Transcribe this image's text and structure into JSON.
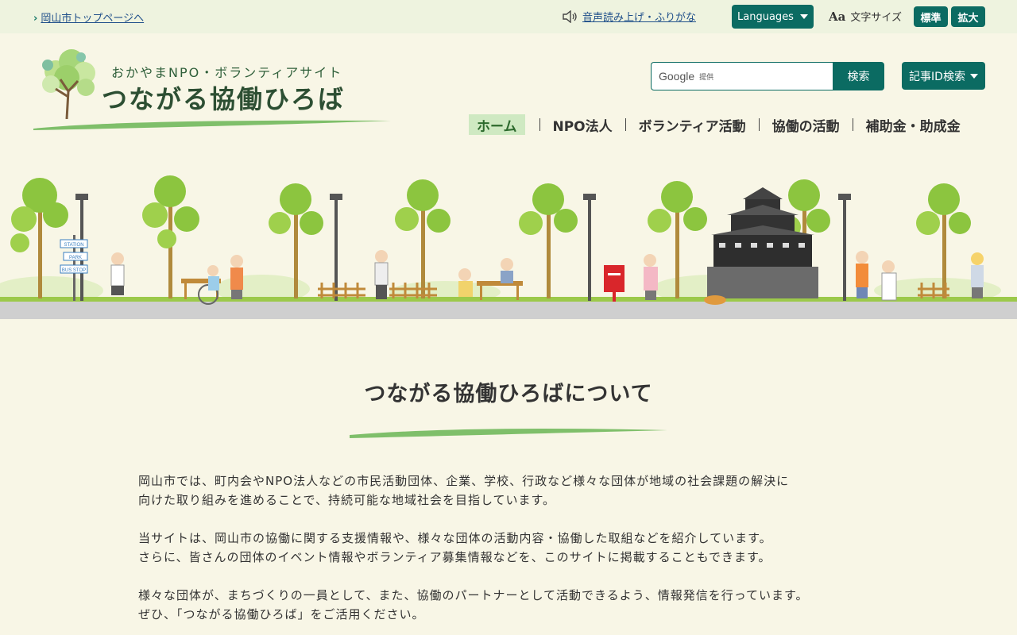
{
  "topbar": {
    "city_top_link": "岡山市トップページへ",
    "speech_link": "音声読み上げ・ふりがな",
    "languages_label": "Languages",
    "font_size_label": "文字サイズ",
    "font_size_standard": "標準",
    "font_size_large": "拡大"
  },
  "logo": {
    "subtitle": "おかやまNPO・ボランティアサイト",
    "title": "つながる協働ひろば"
  },
  "search": {
    "provider": "Google",
    "provider_suffix": "提供",
    "button_label": "検索",
    "article_id_label": "記事ID検索"
  },
  "nav": {
    "items": [
      {
        "label": "ホーム"
      },
      {
        "label": "NPO法人"
      },
      {
        "label": "ボランティア活動"
      },
      {
        "label": "協働の活動"
      },
      {
        "label": "補助金・助成金"
      }
    ]
  },
  "hero": {
    "sign_labels": [
      "STATION",
      "PARK",
      "BUS STOP"
    ]
  },
  "about": {
    "title": "つながる協働ひろばについて",
    "paragraphs": [
      [
        "岡山市では、町内会やNPO法人などの市民活動団体、企業、学校、行政など様々な団体が地域の社会課題の解決に",
        "向けた取り組みを進めることで、持続可能な地域社会を目指しています。"
      ],
      [
        "当サイトは、岡山市の協働に関する支援情報や、様々な団体の活動内容・協働した取組などを紹介しています。",
        "さらに、皆さんの団体のイベント情報やボランティア募集情報などを、このサイトに掲載することもできます。"
      ],
      [
        "様々な団体が、まちづくりの一員として、また、協働のパートナーとして活動できるよう、情報発信を行っています。",
        "ぜひ、「つながる協働ひろば」をご活用ください。"
      ]
    ]
  },
  "colors": {
    "accent": "#0b6b62",
    "background": "#f8f6e6",
    "topbar": "#eef3df",
    "nav_active_bg": "#cfe9c2"
  }
}
